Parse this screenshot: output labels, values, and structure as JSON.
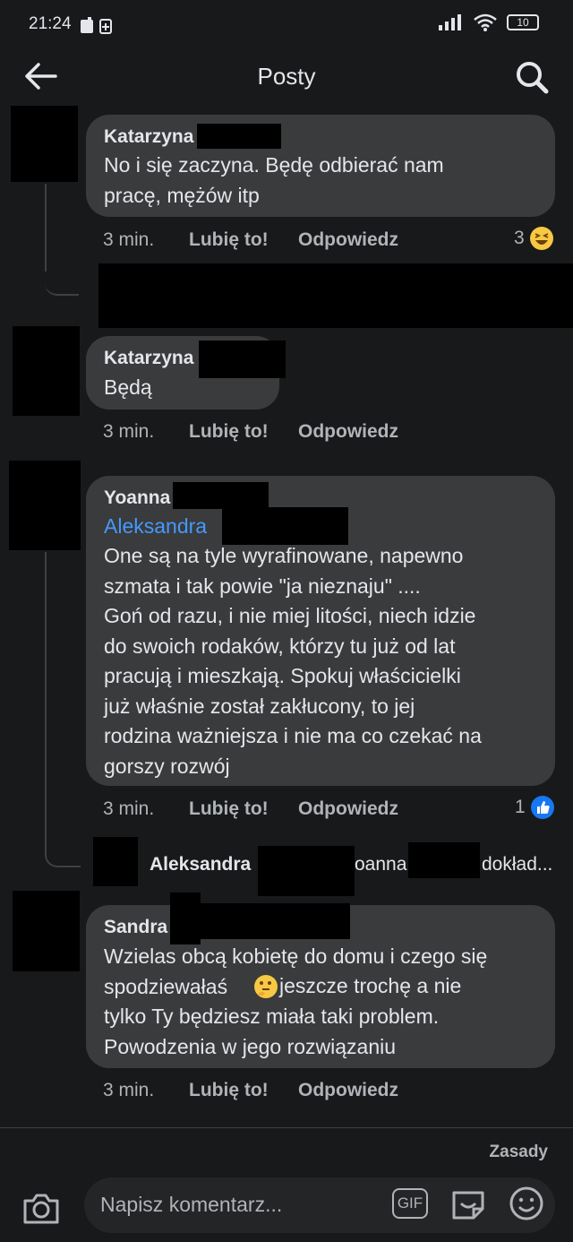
{
  "status": {
    "time": "21:24",
    "battery": "10"
  },
  "header": {
    "title": "Posty"
  },
  "comments": [
    {
      "author": "Katarzyna",
      "text": "No i się zaczyna.  Będę odbierać  nam\npracę,  mężów  itp",
      "time": "3 min.",
      "like": "Lubię to!",
      "reply": "Odpowiedz",
      "reaction_count": "3"
    },
    {
      "author": "Katarzyna",
      "text": "Będą",
      "time": "3 min.",
      "like": "Lubię to!",
      "reply": "Odpowiedz"
    },
    {
      "author": "Yoanna",
      "mention": "Aleksandra",
      "text": "One są na tyle wyrafinowane, napewno\nszmata i tak  powie  \"ja nieznaju\" ....\nGoń od razu, i nie miej litości, niech idzie\ndo swoich rodaków, którzy tu już od lat\npracują i mieszkają. Spokuj właścicielki\njuż właśnie został zakłucony, to jej\nrodzina ważniejsza i nie ma co czekać na\ngorszy rozwój",
      "time": "3 min.",
      "like": "Lubię to!",
      "reply": "Odpowiedz",
      "reaction_count": "1"
    },
    {
      "author": "Sandra",
      "text_a": "Wzielas obcą kobietę do domu i czego się\nspodziewałaś",
      "text_b": " jeszcze trochę a nie",
      "text_c": "tylko Ty będziesz miała taki problem.\nPowodzenia w jego rozwiązaniu",
      "time": "3 min.",
      "like": "Lubię to!",
      "reply": "Odpowiedz"
    }
  ],
  "reply_preview": {
    "author": "Aleksandra",
    "snippet_a": "oanna",
    "snippet_b": "dokład..."
  },
  "footer": {
    "rules": "Zasady",
    "placeholder": "Napisz komentarz...",
    "gif_label": "GIF"
  },
  "icons": {
    "reaction_laugh": "laugh-emoji-icon",
    "reaction_like": "like-icon",
    "thinking": "thinking-emoji-icon"
  },
  "colors": {
    "background": "#18191a",
    "bubble": "#3a3b3c",
    "mention": "#4599ff",
    "like_blue": "#1877f2"
  }
}
